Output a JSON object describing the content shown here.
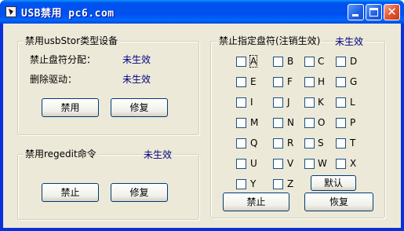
{
  "window": {
    "title": "USB禁用 pc6.com"
  },
  "usb_storage": {
    "legend": "禁用usbStor类型设备",
    "drive_alloc_label": "禁止盘符分配：",
    "drive_alloc_status": "未生效",
    "remove_driver_label": "删除驱动：",
    "remove_driver_status": "未生效",
    "disable_button": "禁用",
    "repair_button": "修复"
  },
  "regedit": {
    "legend": "禁用regedit命令",
    "status": "未生效",
    "disable_button": "禁止",
    "repair_button": "修复"
  },
  "drive_letters": {
    "legend": "禁止指定盘符(注销生效)",
    "status": "未生效",
    "letters": [
      "A",
      "B",
      "C",
      "D",
      "E",
      "F",
      "H",
      "G",
      "I",
      "J",
      "K",
      "L",
      "M",
      "N",
      "O",
      "P",
      "Q",
      "R",
      "S",
      "T",
      "U",
      "V",
      "W",
      "X",
      "Y",
      "Z"
    ],
    "default_button": "默认",
    "disable_button": "禁止",
    "restore_button": "恢复"
  }
}
